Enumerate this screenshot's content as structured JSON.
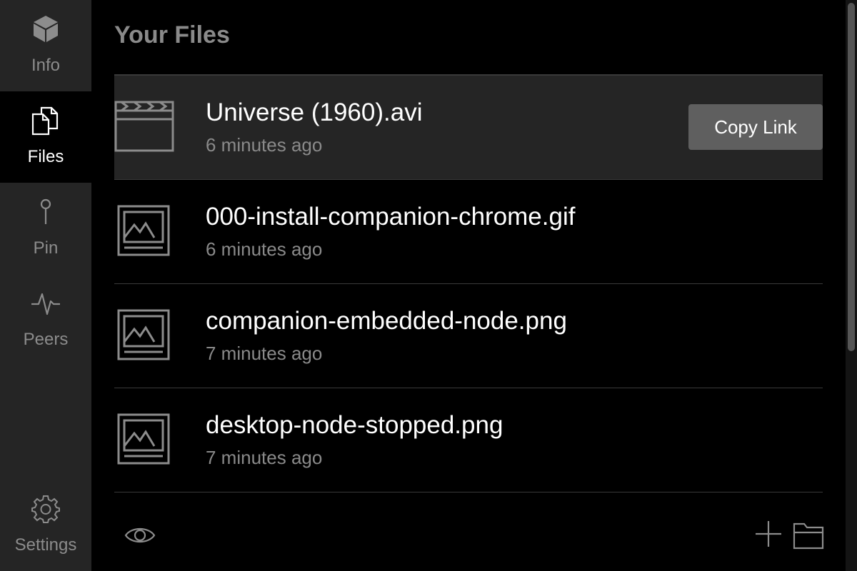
{
  "sidebar": {
    "items": [
      {
        "label": "Info",
        "icon": "cube-icon",
        "active": false
      },
      {
        "label": "Files",
        "icon": "files-icon",
        "active": true
      },
      {
        "label": "Pin",
        "icon": "pin-icon",
        "active": false
      },
      {
        "label": "Peers",
        "icon": "pulse-icon",
        "active": false
      },
      {
        "label": "Settings",
        "icon": "gear-icon",
        "active": false
      }
    ]
  },
  "main": {
    "title": "Your Files",
    "files": [
      {
        "name": "Universe (1960).avi",
        "time": "6 minutes ago",
        "icon": "video-file-icon",
        "selected": true
      },
      {
        "name": "000-install-companion-chrome.gif",
        "time": "6 minutes ago",
        "icon": "image-file-icon",
        "selected": false
      },
      {
        "name": "companion-embedded-node.png",
        "time": "7 minutes ago",
        "icon": "image-file-icon",
        "selected": false
      },
      {
        "name": "desktop-node-stopped.png",
        "time": "7 minutes ago",
        "icon": "image-file-icon",
        "selected": false
      }
    ],
    "copy_link_label": "Copy Link"
  },
  "bottom_bar": {
    "icons": [
      "eye-icon",
      "plus-icon",
      "folder-icon"
    ]
  },
  "colors": {
    "sidebar_bg": "#252525",
    "main_bg": "#000000",
    "selected_row_bg": "#252525",
    "button_bg": "#5f5f5f",
    "muted_text": "#8a8a8a"
  }
}
